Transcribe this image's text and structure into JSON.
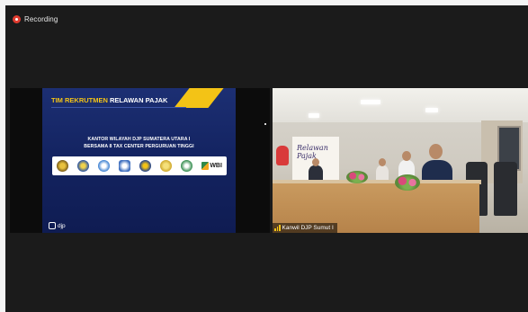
{
  "recording": {
    "label": "Recording",
    "color": "#e03b2f"
  },
  "shared_slide": {
    "title_word1": "TIM REKRUTMEN",
    "title_word2": "RELAWAN PAJAK",
    "subtitle_line1": "KANTOR WILAYAH DJP SUMATERA UTARA I",
    "subtitle_line2": "BERSAMA 8 TAX CENTER PERGURUAN TINGGI",
    "logos": [
      "university-logo",
      "university-logo",
      "university-logo",
      "university-logo",
      "university-logo",
      "university-logo",
      "university-logo"
    ],
    "wbi_label": "WBI",
    "footer_brand": "djp",
    "accent_color": "#f3c316",
    "background_color": "#142462"
  },
  "camera_tile": {
    "participant_name": "Kanwil DJP Sumut I",
    "banner_text_line1": "Relawan",
    "banner_text_line2": "Pajak",
    "signal_icon": "signal-bars-icon"
  }
}
